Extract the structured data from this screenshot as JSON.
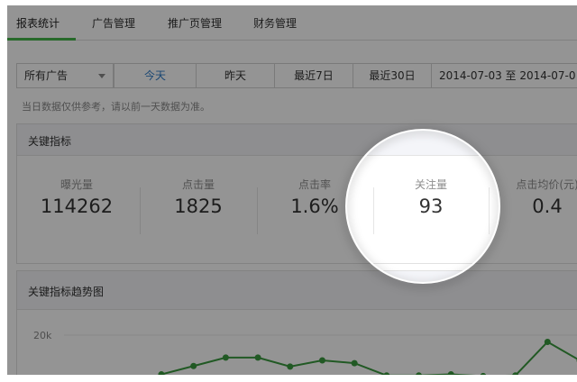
{
  "tabs": [
    {
      "label": "报表统计",
      "active": true
    },
    {
      "label": "广告管理"
    },
    {
      "label": "推广页管理"
    },
    {
      "label": "财务管理"
    }
  ],
  "filters": {
    "ad_select": "所有广告",
    "ranges": [
      "今天",
      "昨天",
      "最近7日",
      "最近30日"
    ],
    "active_range": "今天",
    "date_range": "2014-07-03 至 2014-07-0"
  },
  "note": "当日数据仅供参考，请以前一天数据为准。",
  "key_metrics": {
    "title": "关键指标",
    "items": [
      {
        "label": "曝光量",
        "value": "114262"
      },
      {
        "label": "点击量",
        "value": "1825"
      },
      {
        "label": "点击率",
        "value": "1.6%"
      },
      {
        "label": "关注量",
        "value": "93"
      },
      {
        "label": "点击均价(元)",
        "value": "0.4"
      }
    ]
  },
  "trend": {
    "title": "关键指标趋势图",
    "y_tick_label": "20k"
  },
  "colors": {
    "accent_green": "#44b549",
    "link_blue": "#2d7ac7",
    "line_green": "#3a9a3e"
  },
  "chart_data": {
    "type": "line",
    "title": "关键指标趋势图",
    "y_ticks": [
      "20k"
    ],
    "series": [
      {
        "values": [
          13000,
          14500,
          16000,
          16000,
          14400,
          15500,
          15000,
          12800,
          12800,
          13000,
          12700,
          12800,
          18800,
          15500
        ]
      }
    ],
    "grid": true
  }
}
